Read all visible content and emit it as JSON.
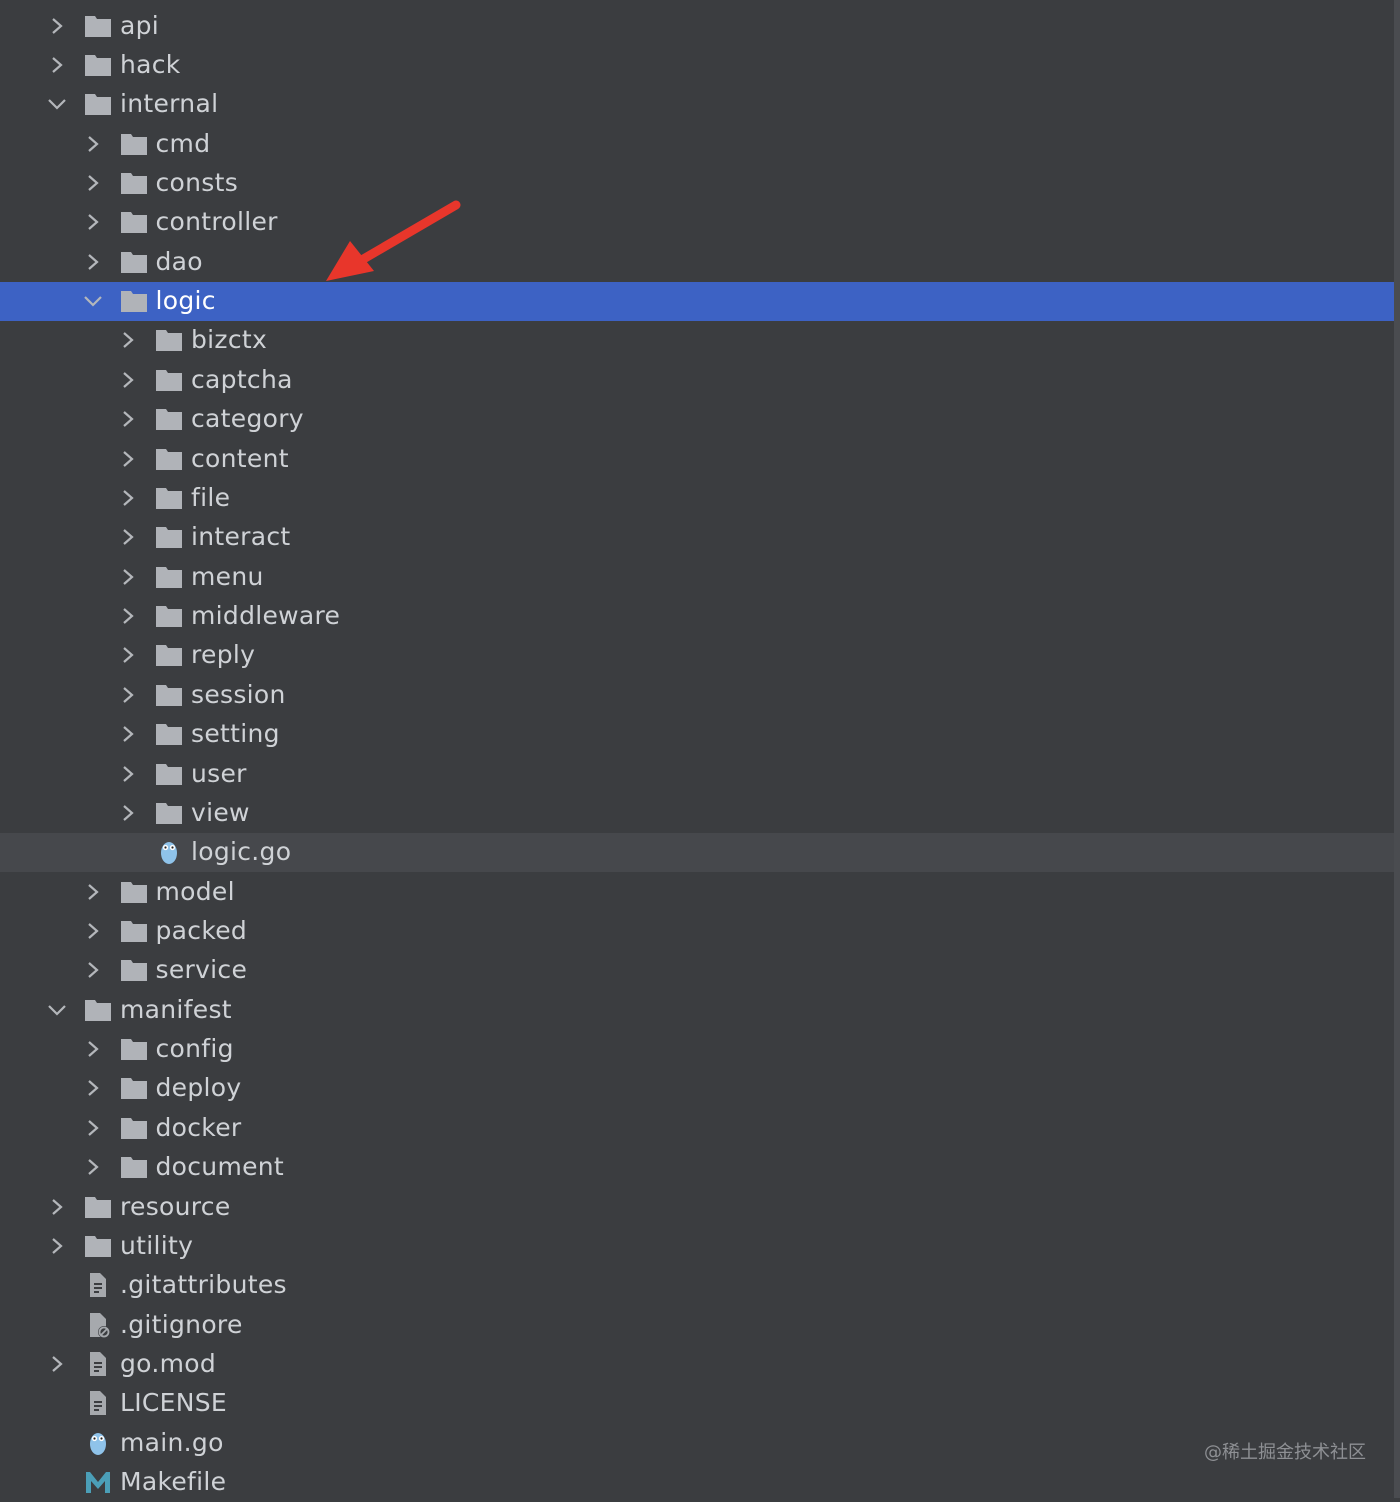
{
  "tree": {
    "items": [
      {
        "label": "api",
        "level": 0,
        "type": "folder",
        "expandable": true,
        "expanded": false
      },
      {
        "label": "hack",
        "level": 0,
        "type": "folder",
        "expandable": true,
        "expanded": false
      },
      {
        "label": "internal",
        "level": 0,
        "type": "folder",
        "expandable": true,
        "expanded": true
      },
      {
        "label": "cmd",
        "level": 1,
        "type": "folder",
        "expandable": true,
        "expanded": false
      },
      {
        "label": "consts",
        "level": 1,
        "type": "folder",
        "expandable": true,
        "expanded": false
      },
      {
        "label": "controller",
        "level": 1,
        "type": "folder",
        "expandable": true,
        "expanded": false
      },
      {
        "label": "dao",
        "level": 1,
        "type": "folder",
        "expandable": true,
        "expanded": false
      },
      {
        "label": "logic",
        "level": 1,
        "type": "folder",
        "expandable": true,
        "expanded": true,
        "selected": true
      },
      {
        "label": "bizctx",
        "level": 2,
        "type": "folder",
        "expandable": true,
        "expanded": false
      },
      {
        "label": "captcha",
        "level": 2,
        "type": "folder",
        "expandable": true,
        "expanded": false
      },
      {
        "label": "category",
        "level": 2,
        "type": "folder",
        "expandable": true,
        "expanded": false
      },
      {
        "label": "content",
        "level": 2,
        "type": "folder",
        "expandable": true,
        "expanded": false
      },
      {
        "label": "file",
        "level": 2,
        "type": "folder",
        "expandable": true,
        "expanded": false
      },
      {
        "label": "interact",
        "level": 2,
        "type": "folder",
        "expandable": true,
        "expanded": false
      },
      {
        "label": "menu",
        "level": 2,
        "type": "folder",
        "expandable": true,
        "expanded": false
      },
      {
        "label": "middleware",
        "level": 2,
        "type": "folder",
        "expandable": true,
        "expanded": false
      },
      {
        "label": "reply",
        "level": 2,
        "type": "folder",
        "expandable": true,
        "expanded": false
      },
      {
        "label": "session",
        "level": 2,
        "type": "folder",
        "expandable": true,
        "expanded": false
      },
      {
        "label": "setting",
        "level": 2,
        "type": "folder",
        "expandable": true,
        "expanded": false
      },
      {
        "label": "user",
        "level": 2,
        "type": "folder",
        "expandable": true,
        "expanded": false
      },
      {
        "label": "view",
        "level": 2,
        "type": "folder",
        "expandable": true,
        "expanded": false
      },
      {
        "label": "logic.go",
        "level": 2,
        "type": "go-file",
        "expandable": false,
        "hover": true
      },
      {
        "label": "model",
        "level": 1,
        "type": "folder",
        "expandable": true,
        "expanded": false
      },
      {
        "label": "packed",
        "level": 1,
        "type": "folder",
        "expandable": true,
        "expanded": false
      },
      {
        "label": "service",
        "level": 1,
        "type": "folder",
        "expandable": true,
        "expanded": false
      },
      {
        "label": "manifest",
        "level": 0,
        "type": "folder",
        "expandable": true,
        "expanded": true
      },
      {
        "label": "config",
        "level": 1,
        "type": "folder",
        "expandable": true,
        "expanded": false
      },
      {
        "label": "deploy",
        "level": 1,
        "type": "folder",
        "expandable": true,
        "expanded": false
      },
      {
        "label": "docker",
        "level": 1,
        "type": "folder",
        "expandable": true,
        "expanded": false
      },
      {
        "label": "document",
        "level": 1,
        "type": "folder",
        "expandable": true,
        "expanded": false
      },
      {
        "label": "resource",
        "level": 0,
        "type": "folder",
        "expandable": true,
        "expanded": false
      },
      {
        "label": "utility",
        "level": 0,
        "type": "folder",
        "expandable": true,
        "expanded": false
      },
      {
        "label": ".gitattributes",
        "level": 0,
        "type": "text-file",
        "expandable": false
      },
      {
        "label": ".gitignore",
        "level": 0,
        "type": "ignore-file",
        "expandable": false
      },
      {
        "label": "go.mod",
        "level": 0,
        "type": "text-file",
        "expandable": true,
        "expanded": false
      },
      {
        "label": "LICENSE",
        "level": 0,
        "type": "text-file",
        "expandable": false
      },
      {
        "label": "main.go",
        "level": 0,
        "type": "go-file",
        "expandable": false
      },
      {
        "label": "Makefile",
        "level": 0,
        "type": "makefile",
        "expandable": false
      }
    ]
  },
  "annotation": {
    "color": "#e8362b"
  },
  "colors": {
    "selection": "#3d62c4",
    "background": "#3b3d40",
    "folder": "#b0b3b8",
    "gopher": "#8fc3ea",
    "makefile": "#4b9fb8"
  },
  "watermark": "@稀土掘金技术社区"
}
